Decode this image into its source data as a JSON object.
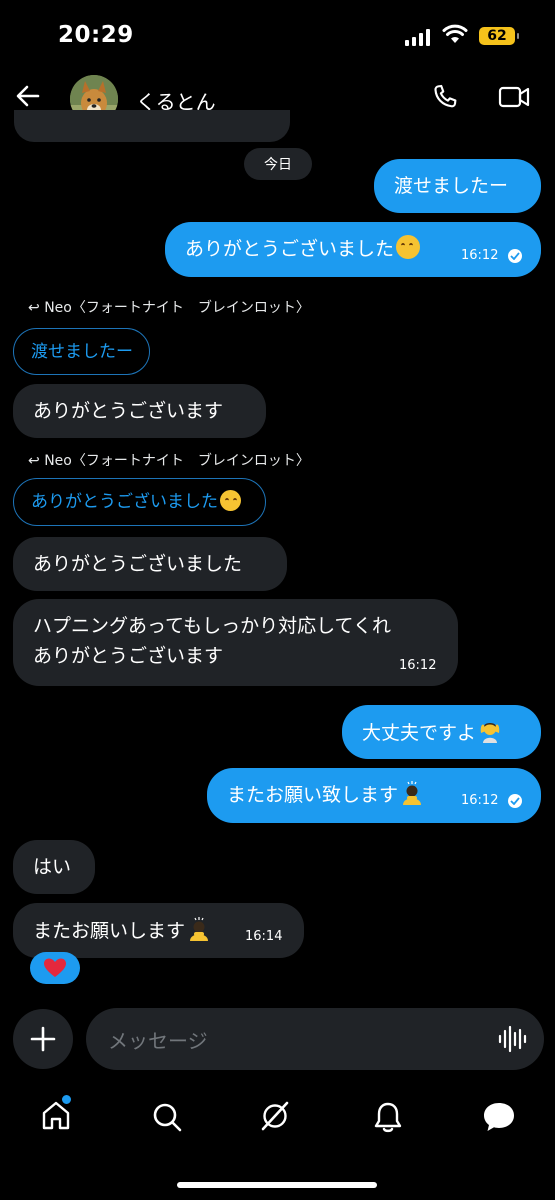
{
  "status_bar": {
    "time": "20:29",
    "battery": "62"
  },
  "header": {
    "contact_name": "くるとん"
  },
  "date_chip": "今日",
  "messages": [
    {
      "text": "渡せましたー"
    },
    {
      "text": "ありがとうございました",
      "time": "16:12"
    },
    {
      "reply_label": "Neo〈フォートナイト　ブレインロット〉",
      "quoted": "渡せましたー"
    },
    {
      "text": "ありがとうございます"
    },
    {
      "reply_label": "Neo〈フォートナイト　ブレインロット〉",
      "quoted": "ありがとうございました"
    },
    {
      "text": "ありがとうございました"
    },
    {
      "line1": "ハプニングあってもしっかり対応してくれ",
      "line2": "ありがとうございます",
      "time": "16:12"
    },
    {
      "text": "大丈夫ですよ"
    },
    {
      "text": "またお願い致します",
      "time": "16:12"
    },
    {
      "text": "はい"
    },
    {
      "text": "またお願いします",
      "time": "16:14"
    }
  ],
  "composer": {
    "placeholder": "メッセージ"
  },
  "icons": {
    "back": "back-arrow-icon",
    "phone": "phone-icon",
    "video": "video-icon",
    "plus": "plus-icon",
    "voice": "voice-wave-icon",
    "heart": "heart-icon",
    "nav": [
      "home-icon",
      "search-icon",
      "grok-icon",
      "bell-icon",
      "messages-icon"
    ]
  },
  "colors": {
    "accent": "#1d9bf0",
    "incoming": "#202327",
    "battery": "#f5c21b",
    "background": "#000000"
  }
}
